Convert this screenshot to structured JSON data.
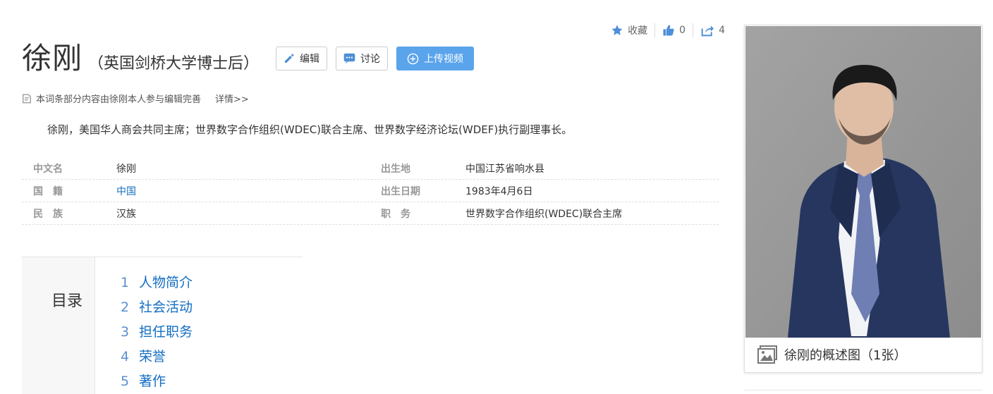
{
  "actions": {
    "favorite_label": "收藏",
    "like_count": "0",
    "share_count": "4"
  },
  "title": {
    "name": "徐刚",
    "subtitle": "（英国剑桥大学博士后）",
    "edit_label": "编辑",
    "discuss_label": "讨论",
    "upload_label": "上传视频"
  },
  "note": {
    "text": "本词条部分内容由徐刚本人参与编辑完善",
    "detail_link": "详情>>"
  },
  "summary": "徐刚，美国华人商会共同主席；世界数字合作组织(WDEC)联合主席、世界数字经济论坛(WDEF)执行副理事长。",
  "info": [
    {
      "k1": "中文名",
      "v1": "徐刚",
      "k2": "出生地",
      "v2": "中国江苏省响水县"
    },
    {
      "k1": "国　籍",
      "v1": "中国",
      "k2": "出生日期",
      "v2": "1983年4月6日"
    },
    {
      "k1": "民　族",
      "v1": "汉族",
      "k2": "职　务",
      "v2": "世界数字合作组织(WDEC)联合主席"
    }
  ],
  "catalog": {
    "title": "目录",
    "items": [
      {
        "num": "1",
        "label": "人物简介"
      },
      {
        "num": "2",
        "label": "社会活动"
      },
      {
        "num": "3",
        "label": "担任职务"
      },
      {
        "num": "4",
        "label": "荣誉"
      },
      {
        "num": "5",
        "label": "著作"
      }
    ]
  },
  "image": {
    "caption": "徐刚的概述图（1张）"
  },
  "colors": {
    "accent": "#5aa4ec",
    "link": "#136ec2",
    "photo_bg": "#979797",
    "suit": "#26365f"
  }
}
